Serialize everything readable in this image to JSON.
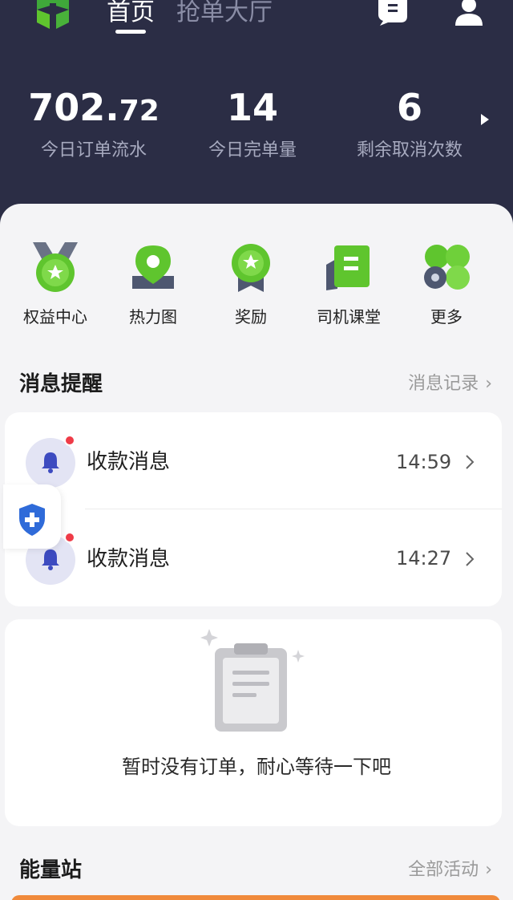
{
  "header": {
    "tabs": [
      {
        "label": "首页",
        "active": true
      },
      {
        "label": "抢单大厅",
        "active": false
      }
    ],
    "icons": [
      "logo-icon",
      "message-icon",
      "user-icon"
    ]
  },
  "stats": [
    {
      "value_int": "702.",
      "value_dec": "72",
      "label": "今日订单流水"
    },
    {
      "value_int": "14",
      "value_dec": "",
      "label": "今日完单量"
    },
    {
      "value_int": "6",
      "value_dec": "",
      "label": "剩余取消次数"
    }
  ],
  "quick_actions": [
    {
      "label": "权益中心",
      "icon": "medal-icon"
    },
    {
      "label": "热力图",
      "icon": "map-pin-icon"
    },
    {
      "label": "奖励",
      "icon": "star-badge-icon"
    },
    {
      "label": "司机课堂",
      "icon": "book-icon"
    },
    {
      "label": "更多",
      "icon": "more-grid-icon"
    }
  ],
  "messages": {
    "title": "消息提醒",
    "link": "消息记录",
    "items": [
      {
        "title": "收款消息",
        "time": "14:59",
        "unread": true
      },
      {
        "title": "收款消息",
        "time": "14:27",
        "unread": true
      }
    ]
  },
  "orders": {
    "empty_text": "暂时没有订单，耐心等待一下吧"
  },
  "energy": {
    "title": "能量站",
    "link": "全部活动"
  },
  "colors": {
    "header_bg": "#2b2d45",
    "accent_green": "#5fc52e",
    "badge_red": "#ef3b47",
    "shield_blue": "#2f6bd9",
    "orange": "#f08a3b"
  }
}
